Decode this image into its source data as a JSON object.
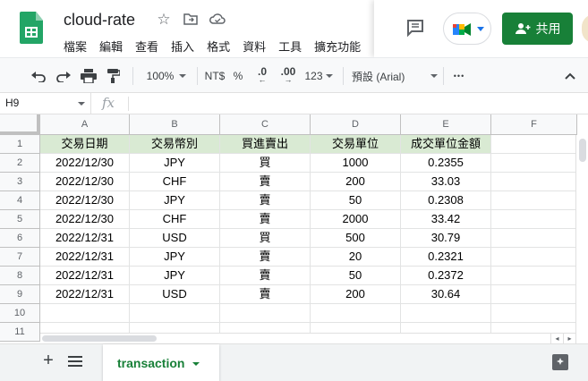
{
  "app": {
    "doc_title": "cloud-rate",
    "menus": [
      "檔案",
      "編輯",
      "查看",
      "插入",
      "格式",
      "資料",
      "工具",
      "擴充功能"
    ],
    "share_label": "共用",
    "brand_color": "#188038"
  },
  "toolbar": {
    "zoom": "100%",
    "currency": "NT$",
    "percent": "%",
    "decrease_decimal": ".0",
    "increase_decimal": ".00",
    "number_format": "123",
    "font": "預設 (Arial)",
    "more": "•••"
  },
  "formula_bar": {
    "name_box": "H9",
    "fx": "fx",
    "value": ""
  },
  "sheet": {
    "columns": [
      "A",
      "B",
      "C",
      "D",
      "E",
      "F"
    ],
    "row_numbers": [
      "1",
      "2",
      "3",
      "4",
      "5",
      "6",
      "7",
      "8",
      "9",
      "10",
      "11"
    ],
    "header_fill": "#d9ead3",
    "rows": [
      [
        "交易日期",
        "交易幣別",
        "買進賣出",
        "交易單位",
        "成交單位金額",
        ""
      ],
      [
        "2022/12/30",
        "JPY",
        "買",
        "1000",
        "0.2355",
        ""
      ],
      [
        "2022/12/30",
        "CHF",
        "賣",
        "200",
        "33.03",
        ""
      ],
      [
        "2022/12/30",
        "JPY",
        "賣",
        "50",
        "0.2308",
        ""
      ],
      [
        "2022/12/30",
        "CHF",
        "賣",
        "2000",
        "33.42",
        ""
      ],
      [
        "2022/12/31",
        "USD",
        "買",
        "500",
        "30.79",
        ""
      ],
      [
        "2022/12/31",
        "JPY",
        "賣",
        "20",
        "0.2321",
        ""
      ],
      [
        "2022/12/31",
        "JPY",
        "賣",
        "50",
        "0.2372",
        ""
      ],
      [
        "2022/12/31",
        "USD",
        "賣",
        "200",
        "30.64",
        ""
      ],
      [
        "",
        "",
        "",
        "",
        "",
        ""
      ],
      [
        "",
        "",
        "",
        "",
        "",
        ""
      ]
    ]
  },
  "tabs": {
    "add": "+",
    "active_sheet": "transaction"
  }
}
